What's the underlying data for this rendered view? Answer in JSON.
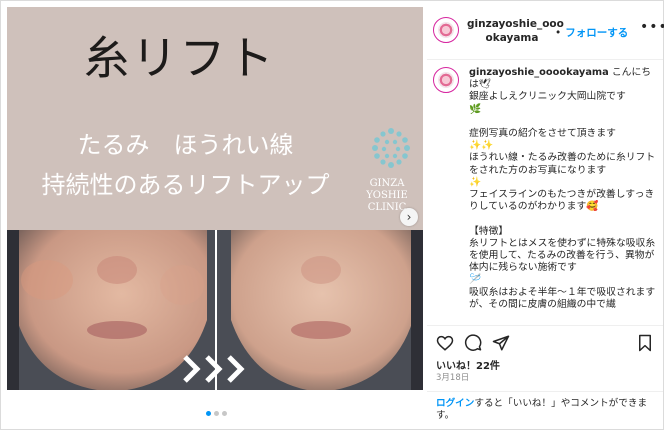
{
  "post": {
    "headline": "糸リフト",
    "subtitle_line1": "たるみ　ほうれい線",
    "subtitle_line2": "持続性のあるリフトアップ",
    "clinic_line1": "GINZA",
    "clinic_line2": "YOSHIE CLINIC",
    "next_icon": "chevron-right-icon",
    "carousel_dots": 3,
    "active_dot": 0,
    "colors": {
      "banner_bg": "#cfc1bb",
      "photo_bg": "#3a3f49",
      "accent": "#0095f6"
    }
  },
  "header": {
    "username_line1": "ginzayoshie_ooo",
    "username_line2": "okayama",
    "separator": "•",
    "follow_label": "フォローする",
    "more_icon": "ellipsis-icon"
  },
  "caption": {
    "username": "ginzayoshie_ooookayama",
    "text": " こんにちは🕊\n銀座よしえクリニック大岡山院です\n🌿\n\n症例写真の紹介をさせて頂きます\n✨✨\nほうれい線・たるみ改善のために糸リフトをされた方のお写真になります\n✨\nフェイスラインのもたつきが改善しすっきりしているのがわかります🥰\n\n【特徴】\n糸リフトとはメスを使わずに特殊な吸収糸を使用して、たるみの改善を行う、異物が体内に残らない施術です\n🪡\n吸収糸はおよそ半年〜１年で吸収されますが、その間に皮膚の組織の中で繊"
  },
  "actions": {
    "like_icon": "heart-icon",
    "comment_icon": "comment-icon",
    "share_icon": "share-icon",
    "save_icon": "bookmark-icon"
  },
  "stats": {
    "likes": "いいね！22件",
    "date": "3月18日"
  },
  "footer": {
    "login_link": "ログイン",
    "login_rest": "すると「いいね！」やコメントができます。"
  }
}
